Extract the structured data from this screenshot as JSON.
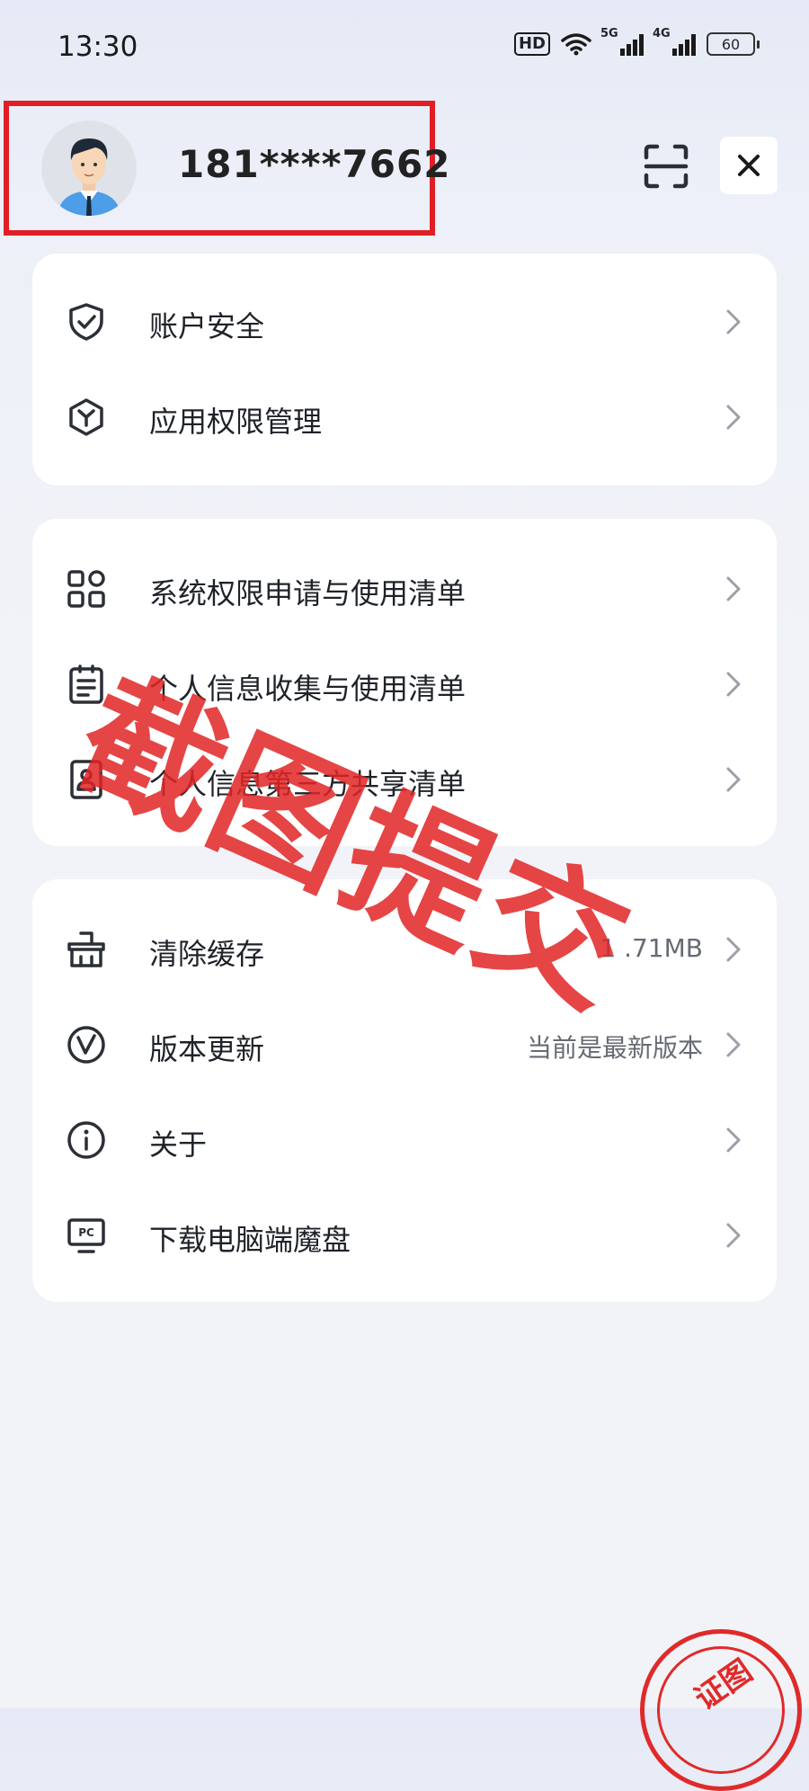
{
  "status_bar": {
    "time": "13:30",
    "hd": "HD",
    "signal_1": "5G",
    "signal_2": "4G",
    "battery": "60"
  },
  "profile": {
    "phone": "181****7662",
    "avatar_icon": "user-avatar-icon",
    "highlight_color": "#e01e25"
  },
  "header": {
    "scan_icon": "scan-icon",
    "close_icon": "close-icon"
  },
  "security_group": {
    "items": [
      {
        "label": "账户安全",
        "icon": "shield-check-icon"
      },
      {
        "label": "应用权限管理",
        "icon": "hexagon-y-icon"
      }
    ]
  },
  "privacy_group": {
    "items": [
      {
        "label": "系统权限申请与使用清单",
        "icon": "grid-apps-icon"
      },
      {
        "label": "个人信息收集与使用清单",
        "icon": "clipboard-list-icon"
      },
      {
        "label": "个人信息第三方共享清单",
        "icon": "contact-card-icon"
      }
    ]
  },
  "general_group": {
    "items": [
      {
        "label": "清除缓存",
        "value": "1 .71MB",
        "icon": "broom-icon"
      },
      {
        "label": "版本更新",
        "value": "当前是最新版本",
        "icon": "version-v-icon"
      },
      {
        "label": "关于",
        "icon": "info-icon"
      },
      {
        "label": "下载电脑端魔盘",
        "icon": "pc-monitor-icon"
      }
    ]
  },
  "overlay": {
    "watermark": "截图提交",
    "seal_text": "证图",
    "watermark_color": "#e22424"
  }
}
